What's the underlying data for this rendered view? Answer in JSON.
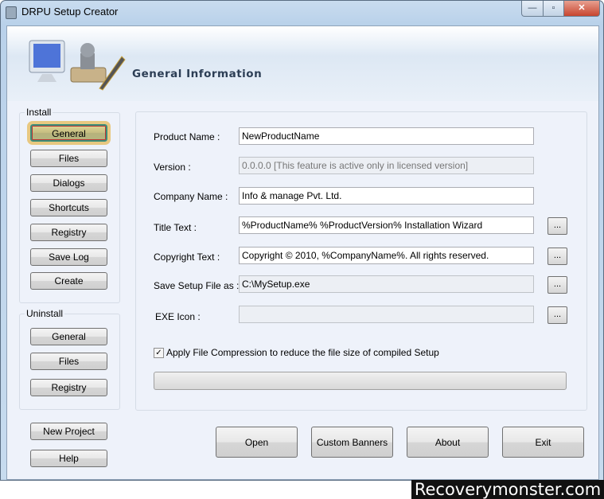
{
  "window": {
    "title": "DRPU Setup Creator",
    "minimize": "—",
    "maximize": "▫",
    "close": "✕"
  },
  "header": {
    "title": "General Information"
  },
  "install": {
    "label": "Install",
    "items": [
      "General",
      "Files",
      "Dialogs",
      "Shortcuts",
      "Registry",
      "Save Log",
      "Create"
    ]
  },
  "uninstall": {
    "label": "Uninstall",
    "items": [
      "General",
      "Files",
      "Registry"
    ]
  },
  "side": {
    "new_project": "New Project",
    "help": "Help"
  },
  "form": {
    "product_name": {
      "label": "Product Name :",
      "value": "NewProductName"
    },
    "version": {
      "label": "Version :",
      "value": "0.0.0.0 [This feature is active only in licensed version]"
    },
    "company_name": {
      "label": "Company Name :",
      "value": "Info & manage Pvt. Ltd."
    },
    "title_text": {
      "label": "Title Text :",
      "value": "%ProductName% %ProductVersion% Installation Wizard"
    },
    "copyright_text": {
      "label": "Copyright Text :",
      "value": "Copyright © 2010, %CompanyName%. All rights reserved."
    },
    "save_setup": {
      "label": "Save Setup File as :",
      "value": "C:\\MySetup.exe"
    },
    "exe_icon": {
      "label": "EXE Icon :",
      "value": ""
    },
    "browse": "...",
    "compression": {
      "label": "Apply File Compression to reduce the file size of compiled Setup",
      "checked": true
    },
    "progress": 0
  },
  "footer": {
    "open": "Open",
    "custom_banners": "Custom Banners",
    "about": "About",
    "exit": "Exit"
  },
  "watermark": "Recoverymonster.com"
}
